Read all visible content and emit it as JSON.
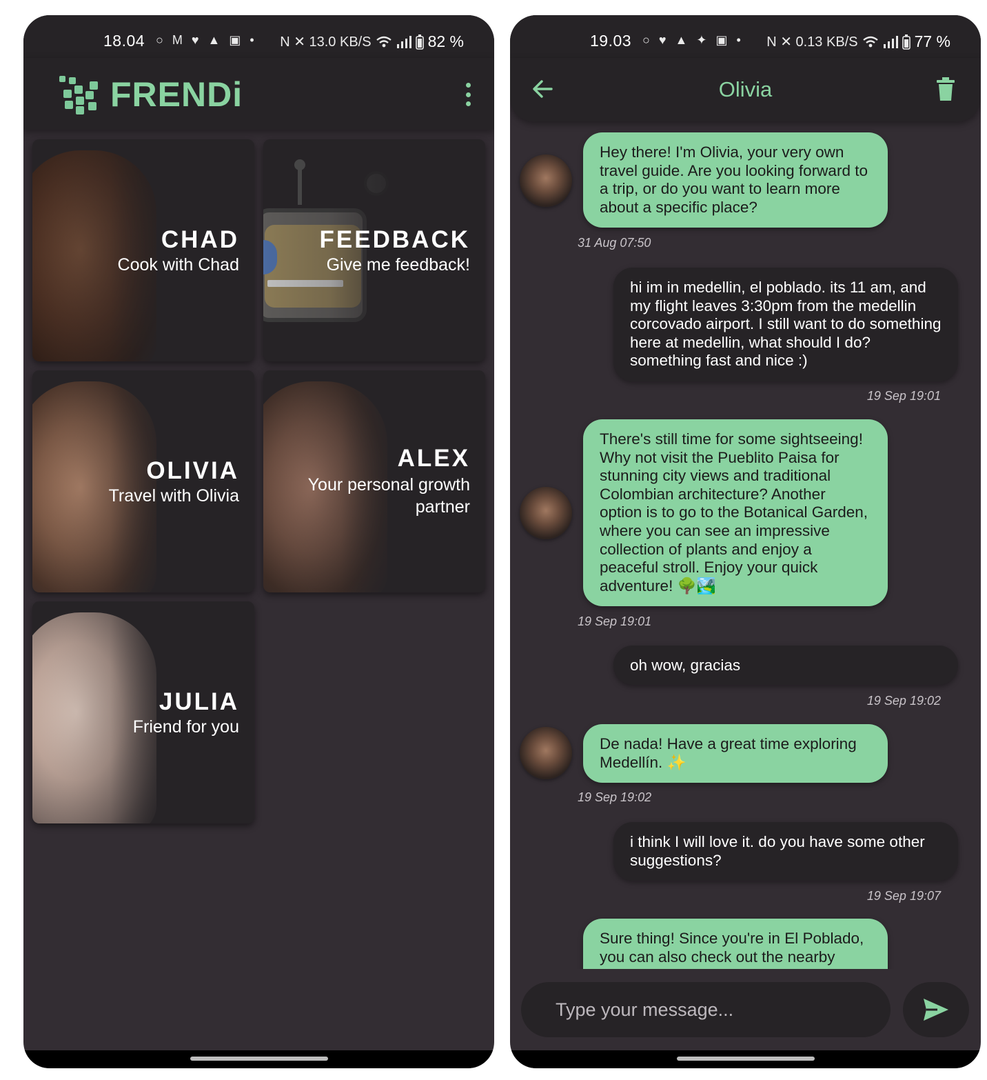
{
  "left_phone": {
    "status": {
      "time": "18.04",
      "notifications": "○ M ♥ ▲ ▣ •",
      "system": "N ✕ 13.0 KB/S",
      "battery": "82 %"
    },
    "app_name": "FRENDi",
    "cards": [
      {
        "title": "CHAD",
        "subtitle": "Cook with Chad"
      },
      {
        "title": "FEEDBACK",
        "subtitle": "Give me feedback!"
      },
      {
        "title": "OLIVIA",
        "subtitle": "Travel with Olivia"
      },
      {
        "title": "ALEX",
        "subtitle_line1": "Your personal growth",
        "subtitle_line2": "partner"
      },
      {
        "title": "JULIA",
        "subtitle": "Friend for you"
      }
    ]
  },
  "right_phone": {
    "status": {
      "time": "19.03",
      "notifications": "○ ♥ ▲ ✦ ▣ •",
      "system": "N ✕ 0.13 KB/S",
      "battery": "77 %"
    },
    "chat_title": "Olivia",
    "messages": [
      {
        "sender": "bot",
        "text": "Hey there! I'm Olivia, your very own travel guide. Are you looking forward to a trip, or do you want to learn more about a specific place?",
        "timestamp": "31 Aug 07:50"
      },
      {
        "sender": "user",
        "text": "hi im in medellin, el poblado. its 11 am, and my flight leaves 3:30pm from the medellin corcovado airport. I still want to do something here at medellin, what should I do? something fast and nice :)",
        "timestamp": "19 Sep 19:01"
      },
      {
        "sender": "bot",
        "text": "There's still time for some sightseeing! Why not visit the Pueblito Paisa for stunning city views and traditional Colombian architecture? Another option is to go to the Botanical Garden, where you can see an impressive collection of plants and enjoy a peaceful stroll. Enjoy your quick adventure!",
        "emoji": "🌳🏞️",
        "timestamp": "19 Sep 19:01"
      },
      {
        "sender": "user",
        "text": "oh wow, gracias",
        "timestamp": "19 Sep 19:02"
      },
      {
        "sender": "bot",
        "text": "De nada! Have a great time exploring Medellín.",
        "emoji": "✨",
        "timestamp": "19 Sep 19:02"
      },
      {
        "sender": "user",
        "text": "i think I will love it. do you have some other suggestions?",
        "timestamp": "19 Sep 19:07"
      },
      {
        "sender": "bot",
        "text": "Sure thing! Since you're in El Poblado, you can also check out the nearby"
      }
    ],
    "input_placeholder": "Type your message..."
  },
  "colors": {
    "accent_green": "#8ad3a1",
    "background": "#332d33",
    "surface": "#262326"
  }
}
